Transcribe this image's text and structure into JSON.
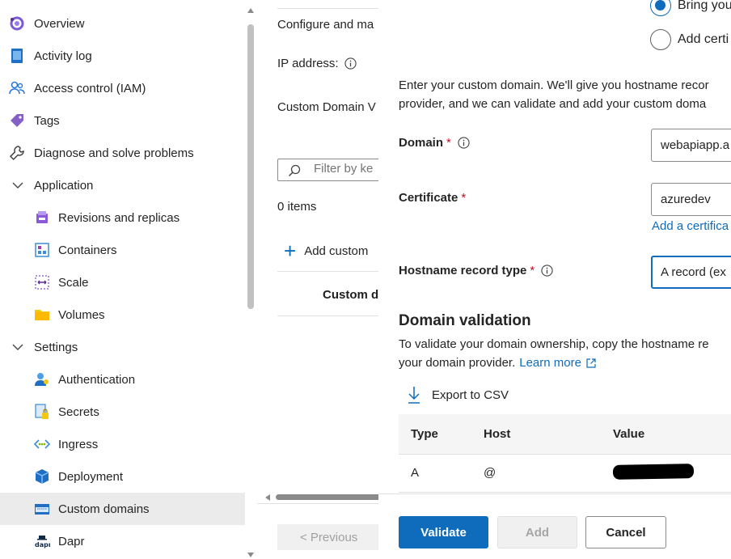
{
  "nav": {
    "overview": "Overview",
    "activity_log": "Activity log",
    "access_control": "Access control (IAM)",
    "tags": "Tags",
    "diagnose": "Diagnose and solve problems",
    "application_group": "Application",
    "revisions": "Revisions and replicas",
    "containers": "Containers",
    "scale": "Scale",
    "volumes": "Volumes",
    "settings_group": "Settings",
    "authentication": "Authentication",
    "secrets": "Secrets",
    "ingress": "Ingress",
    "deployment": "Deployment",
    "custom_domains": "Custom domains",
    "dapr": "Dapr"
  },
  "middle": {
    "configure_text": "Configure and ma",
    "ip_address_label": "IP address:",
    "custom_domain_v": "Custom Domain V",
    "filter_placeholder": "Filter by ke",
    "item_count": "0 items",
    "add_custom": "Add custom",
    "col_custom": "Custom d",
    "previous_button": "< Previous"
  },
  "panel": {
    "radio_bring": "Bring you",
    "radio_add_cert": "Add certi",
    "intro_line1": "Enter your custom domain. We'll give you hostname recor",
    "intro_line2": "provider, and we can validate and add your custom doma",
    "domain_label": "Domain",
    "domain_value": "webapiapp.a",
    "certificate_label": "Certificate",
    "certificate_value": "azuredev",
    "add_certificate_link": "Add a certifica",
    "hostname_record_label": "Hostname record type",
    "hostname_record_value": "A record (ex",
    "required_mark": "*",
    "domain_validation_title": "Domain validation",
    "dv_line1": "To validate your domain ownership, copy the hostname re",
    "dv_line2_prefix": "your domain provider.",
    "learn_more": "Learn more",
    "export_csv": "Export to CSV",
    "table": {
      "headers": [
        "Type",
        "Host",
        "Value"
      ],
      "rows": [
        {
          "type": "A",
          "host": "@"
        }
      ]
    },
    "validate_button": "Validate",
    "add_button": "Add",
    "cancel_button": "Cancel"
  }
}
